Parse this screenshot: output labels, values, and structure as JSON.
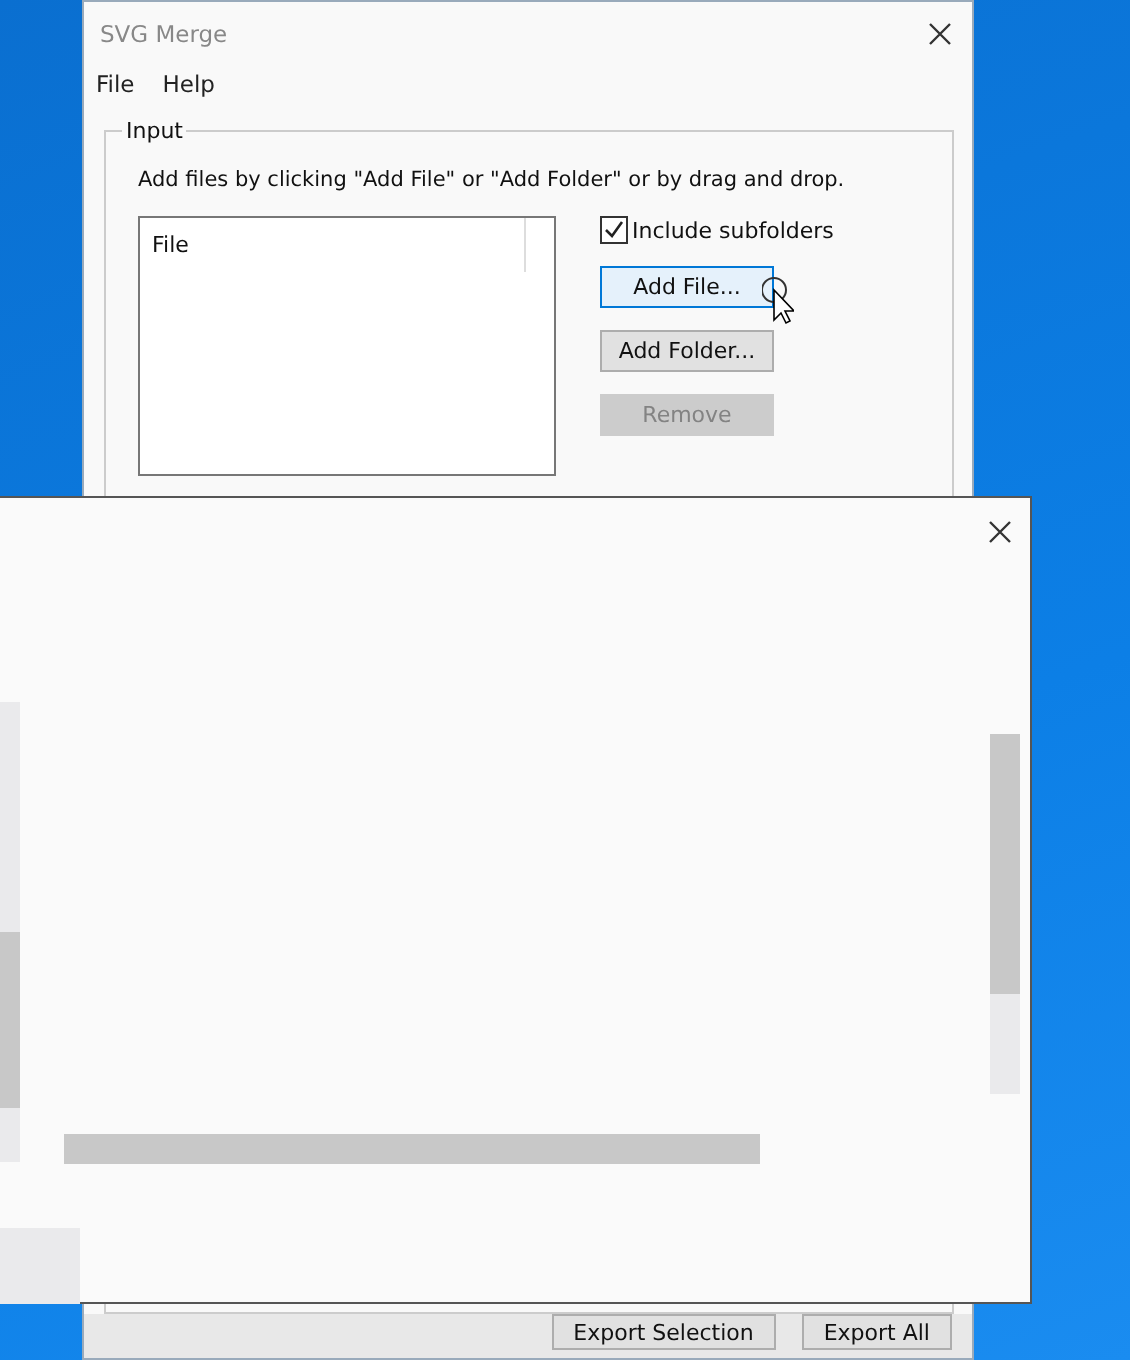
{
  "window": {
    "title": "SVG Merge"
  },
  "menu": [
    "File",
    "Help"
  ],
  "input_group": {
    "label": "Input",
    "instructions": "Add files by clicking \"Add File\" or \"Add Folder\" or by drag and drop.",
    "list_header": "File",
    "include_subfolders": {
      "label": "Include subfolders",
      "checked": true
    },
    "buttons": [
      {
        "label": "Add File...",
        "hovered": true,
        "disabled": false
      },
      {
        "label": "Add Folder...",
        "hovered": false,
        "disabled": false
      },
      {
        "label": "Remove",
        "hovered": false,
        "disabled": true
      }
    ]
  },
  "export_buttons": [
    "Export Selection",
    "Export All"
  ]
}
